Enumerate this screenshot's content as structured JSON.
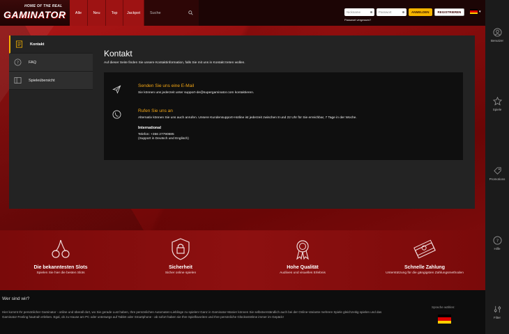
{
  "header": {
    "logo_tagline": "HOME OF THE REAL",
    "logo_brand": "GAMINATOR",
    "nav": [
      "Alle",
      "Neu",
      "Top",
      "Jackpot"
    ],
    "search_placeholder": "Suche",
    "login": {
      "username_placeholder": "Nickname",
      "password_placeholder": "Passwort",
      "login_label": "ANMELDEN",
      "register_label": "REGISTRIEREN",
      "forgot_label": "Passwort vergessen?"
    }
  },
  "colors": {
    "accent": "#f3a614",
    "primary": "#9e1313",
    "panel": "#232323"
  },
  "sidebar": {
    "items": [
      {
        "label": "Kontakt",
        "icon": "contact-card-icon",
        "active": true
      },
      {
        "label": "FAQ",
        "icon": "question-icon",
        "active": false
      },
      {
        "label": "Spieleübersicht",
        "icon": "game-overview-icon",
        "active": false
      }
    ]
  },
  "main": {
    "title": "Kontakt",
    "intro": "Auf dieser Seite finden Sie unsere Kontaktinformation, falls Sie mit uns in Kontakt treten wollen.",
    "email": {
      "title": "Senden Sie uns eine E-Mail",
      "text": "Sie können uns jederzeit unter support-de@supergaminator.com kontaktieren."
    },
    "phone": {
      "title": "Rufen Sie uns an",
      "text": "Alternativ können Sie uns auch anrufen. Unsere Kundensupport-Hotline ist jederzeit zwischen 8 und 22 Uhr für Sie erreichbar, 7 Tage in der Woche.",
      "intl_title": "International",
      "phone_line": "Telefon: +356 27790685",
      "support_line": "(Support in Deutsch und Englisch)"
    }
  },
  "rightbar": [
    {
      "label": "Benutzer",
      "icon": "user-icon"
    },
    {
      "label": "Spiele",
      "icon": "star-icon"
    },
    {
      "label": "Promotions",
      "icon": "tag-icon"
    },
    {
      "label": "Hilfe",
      "icon": "help-icon"
    },
    {
      "label": "Filter",
      "icon": "filter-icon"
    }
  ],
  "features": [
    {
      "title": "Die bekanntesten Slots",
      "subtitle": "Spielen Sie hier die besten Slots",
      "icon": "cherries-icon"
    },
    {
      "title": "Sicherheit",
      "subtitle": "Sicher online spielen",
      "icon": "lock-shield-icon"
    },
    {
      "title": "Hohe Qualität",
      "subtitle": "Audiives und visuelles Erlebnis",
      "icon": "medal-icon"
    },
    {
      "title": "Schnelle Zahlung",
      "subtitle": "Unterstützung für die gängigsten Zahlungsmethoden",
      "icon": "money-stack-icon"
    }
  ],
  "footer": {
    "title": "Wer sind wir?",
    "text": "Hier kommt Ihr persönlicher Gaminator - online und überall dort, wo Sie gerade Lust haben, Ihre persönlichen Automaten-Lieblinge zu spielen! Ganz in Gaminator-Manier können Sie selbstverständlich auch bei der Online-Variante mehrere Spiele gleichzeitig spielen und das Gaminator-Feeling hautnah erleben. Egal, ob zu Hause am PC oder unterwegs auf Tablet oder Smartphone - ab sofort haben sie Ihre Spielfavoriten und Ihre persönliche Glückssträhne immer im Gepäck!",
    "language_label": "Sprache wählen:"
  }
}
